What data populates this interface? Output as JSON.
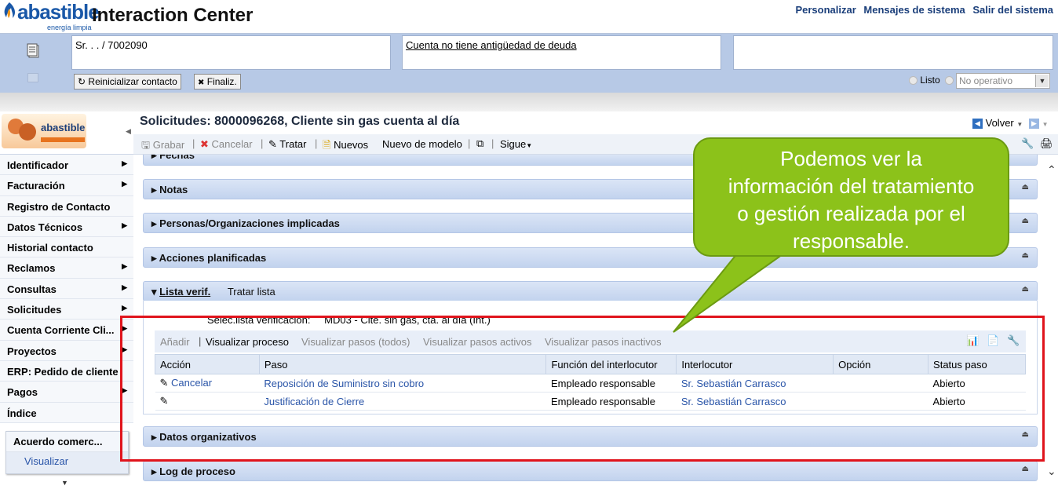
{
  "header": {
    "logo": "abastible",
    "logo_sub": "energía limpia",
    "app_title": "Interaction Center",
    "links": [
      "Personalizar",
      "Mensajes de sistema",
      "Salir del sistema"
    ]
  },
  "context": {
    "contact": "Sr. . . / 7002090",
    "debt_msg": "Cuenta no tiene antigüedad de deuda",
    "btn_reset": "Reinicializar contacto",
    "btn_finish": "Finaliz.",
    "status_listo": "Listo",
    "status_select": "No operativo"
  },
  "sidebar": {
    "logo": "abastible",
    "items": [
      {
        "label": "Identificador",
        "arrow": true
      },
      {
        "label": "Facturación",
        "arrow": true
      },
      {
        "label": "Registro de Contacto",
        "arrow": false
      },
      {
        "label": "Datos Técnicos",
        "arrow": true
      },
      {
        "label": "Historial contacto",
        "arrow": false
      },
      {
        "label": "Reclamos",
        "arrow": true
      },
      {
        "label": "Consultas",
        "arrow": true
      },
      {
        "label": "Solicitudes",
        "arrow": true
      },
      {
        "label": "Cuenta Corriente Cli...",
        "arrow": true
      },
      {
        "label": "Proyectos",
        "arrow": true
      },
      {
        "label": "ERP: Pedido de cliente",
        "arrow": false
      },
      {
        "label": "Pagos",
        "arrow": true
      },
      {
        "label": "Índice",
        "arrow": false
      }
    ],
    "panel_title": "Acuerdo comerc...",
    "panel_link": "Visualizar"
  },
  "main": {
    "title": "Solicitudes: 8000096268, Cliente sin gas cuenta al día",
    "back": "Volver",
    "toolbar": {
      "save": "Grabar",
      "cancel": "Cancelar",
      "treat": "Tratar",
      "new": "Nuevos",
      "new_model": "Nuevo de modelo",
      "next": "Sigue"
    },
    "sections": {
      "fechas": "Fechas",
      "notas": "Notas",
      "personas": "Personas/Organizaciones implicadas",
      "acciones": "Acciones planificadas",
      "lista": "Lista verif.",
      "tratar_lista": "Tratar lista",
      "datos_org": "Datos organizativos",
      "log": "Log de proceso"
    },
    "checklist_label": "Selec.lista verificación:",
    "checklist_value": "MD03 - Clte. sin gas, cta. al día (Int.)",
    "process_toolbar": {
      "add": "Añadir",
      "view_process": "Visualizar proceso",
      "view_all": "Visualizar pasos (todos)",
      "view_active": "Visualizar pasos activos",
      "view_inactive": "Visualizar pasos inactivos"
    },
    "table": {
      "headers": [
        "Acción",
        "Paso",
        "Función del interlocutor",
        "Interlocutor",
        "Opción",
        "Status paso"
      ],
      "rows": [
        {
          "action": "Cancelar",
          "step": "Reposición de Suministro sin cobro",
          "func": "Empleado responsable",
          "partner": "Sr. Sebastián Carrasco",
          "option": "",
          "status": "Abierto"
        },
        {
          "action": "",
          "step": "Justificación de Cierre",
          "func": "Empleado responsable",
          "partner": "Sr. Sebastián Carrasco",
          "option": "",
          "status": "Abierto"
        }
      ]
    }
  },
  "callout": {
    "lines": [
      "Podemos ver la",
      "información del tratamiento",
      "o gestión realizada por el",
      "responsable."
    ]
  }
}
